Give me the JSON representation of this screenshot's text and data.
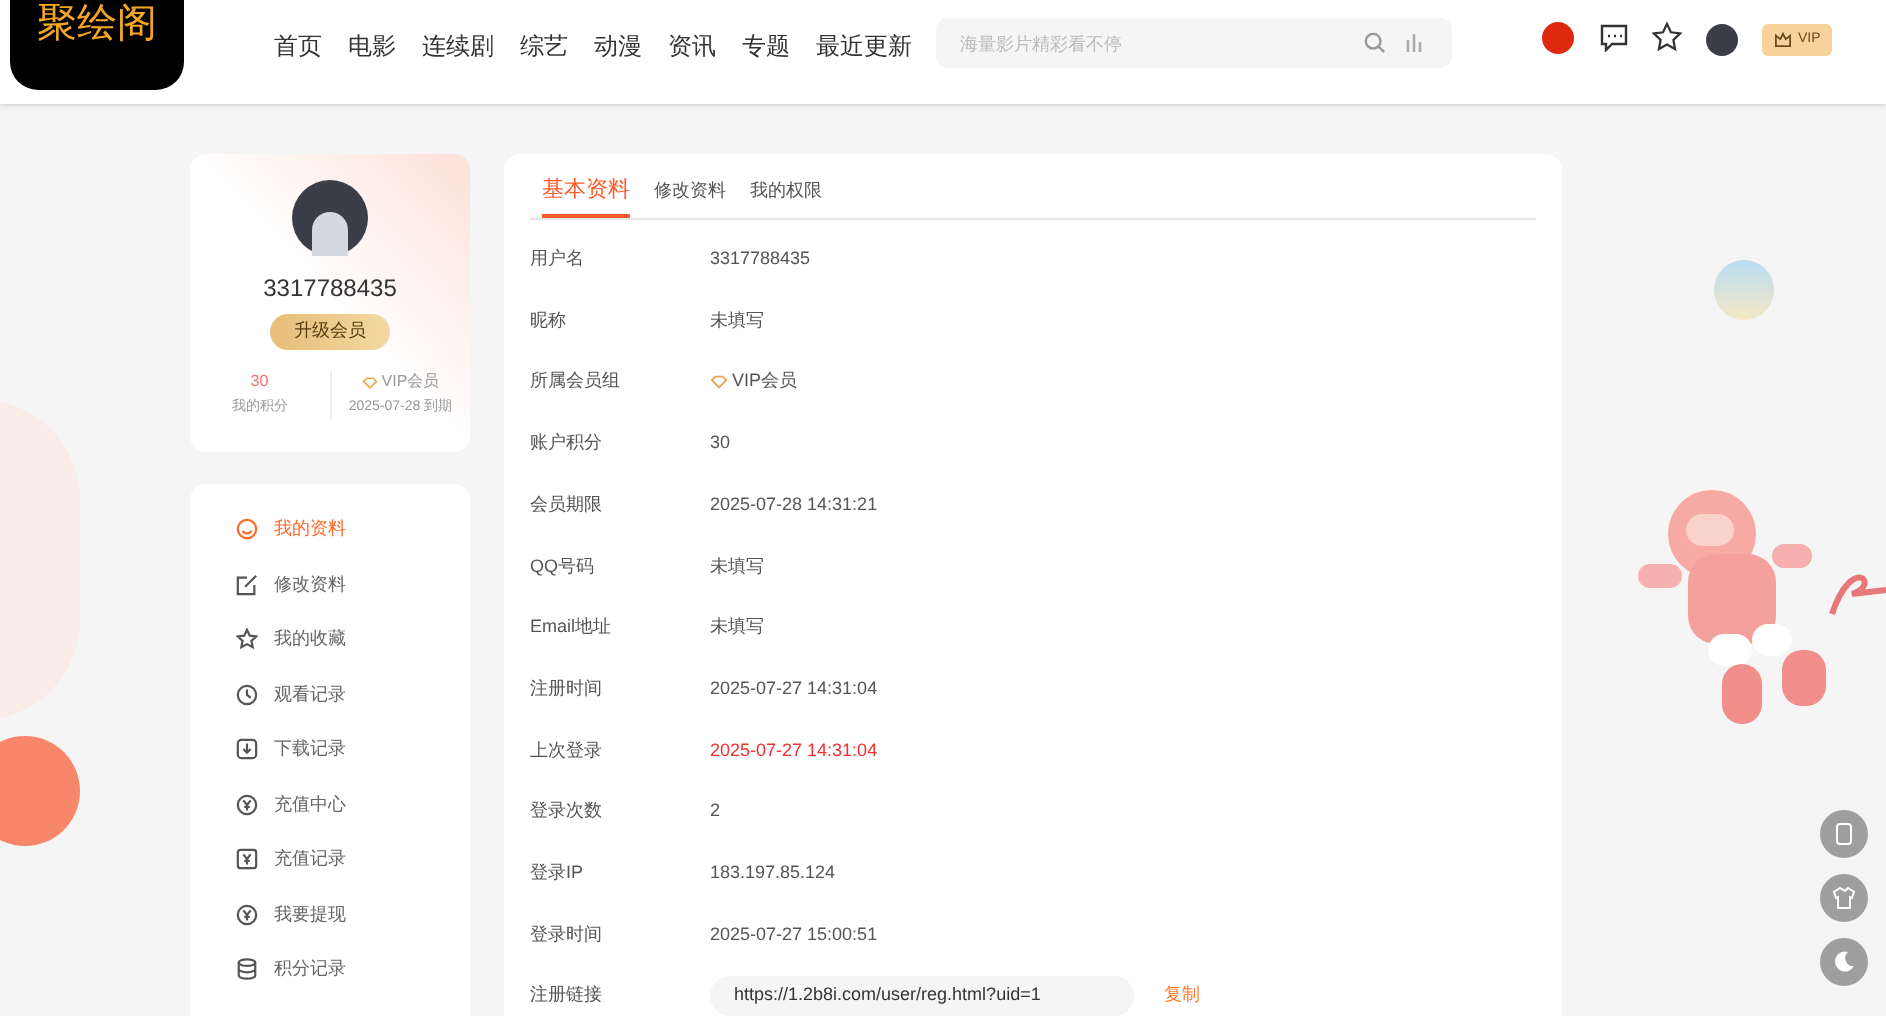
{
  "logo": {
    "text": "聚绘阁"
  },
  "nav": [
    {
      "label": "首页"
    },
    {
      "label": "电影"
    },
    {
      "label": "连续剧"
    },
    {
      "label": "综艺"
    },
    {
      "label": "动漫"
    },
    {
      "label": "资讯"
    },
    {
      "label": "专题"
    },
    {
      "label": "最近更新"
    }
  ],
  "search": {
    "placeholder": "海量影片精彩看不停"
  },
  "header_badge": {
    "label": "VIP"
  },
  "profile": {
    "username": "3317788435",
    "upgrade_button": "升级会员",
    "points_value": "30",
    "points_label": "我的积分",
    "group_value": "VIP会员",
    "expiry": "2025-07-28 到期"
  },
  "sidebar": {
    "items": [
      {
        "label": "我的资料",
        "selected": true
      },
      {
        "label": "修改资料",
        "selected": false
      },
      {
        "label": "我的收藏",
        "selected": false
      },
      {
        "label": "观看记录",
        "selected": false
      },
      {
        "label": "下载记录",
        "selected": false
      },
      {
        "label": "充值中心",
        "selected": false
      },
      {
        "label": "充值记录",
        "selected": false
      },
      {
        "label": "我要提现",
        "selected": false
      },
      {
        "label": "积分记录",
        "selected": false
      }
    ]
  },
  "tabs": [
    {
      "label": "基本资料",
      "selected": true
    },
    {
      "label": "修改资料",
      "selected": false
    },
    {
      "label": "我的权限",
      "selected": false
    }
  ],
  "fields": [
    {
      "label": "用户名",
      "value": "3317788435",
      "kind": "text"
    },
    {
      "label": "昵称",
      "value": "未填写",
      "kind": "text"
    },
    {
      "label": "所属会员组",
      "value": "VIP会员",
      "kind": "vip"
    },
    {
      "label": "账户积分",
      "value": "30",
      "kind": "text"
    },
    {
      "label": "会员期限",
      "value": "2025-07-28 14:31:21",
      "kind": "text"
    },
    {
      "label": "QQ号码",
      "value": "未填写",
      "kind": "text"
    },
    {
      "label": "Email地址",
      "value": "未填写",
      "kind": "text"
    },
    {
      "label": "注册时间",
      "value": "2025-07-27 14:31:04",
      "kind": "text"
    },
    {
      "label": "上次登录",
      "value": "2025-07-27 14:31:04",
      "kind": "highlight"
    },
    {
      "label": "登录次数",
      "value": "2",
      "kind": "text"
    },
    {
      "label": "登录IP",
      "value": "183.197.85.124",
      "kind": "text"
    },
    {
      "label": "登录时间",
      "value": "2025-07-27 15:00:51",
      "kind": "text"
    },
    {
      "label": "注册链接",
      "value": "https://1.2b8i.com/user/reg.html?uid=1",
      "kind": "link",
      "action": "复制"
    }
  ]
}
